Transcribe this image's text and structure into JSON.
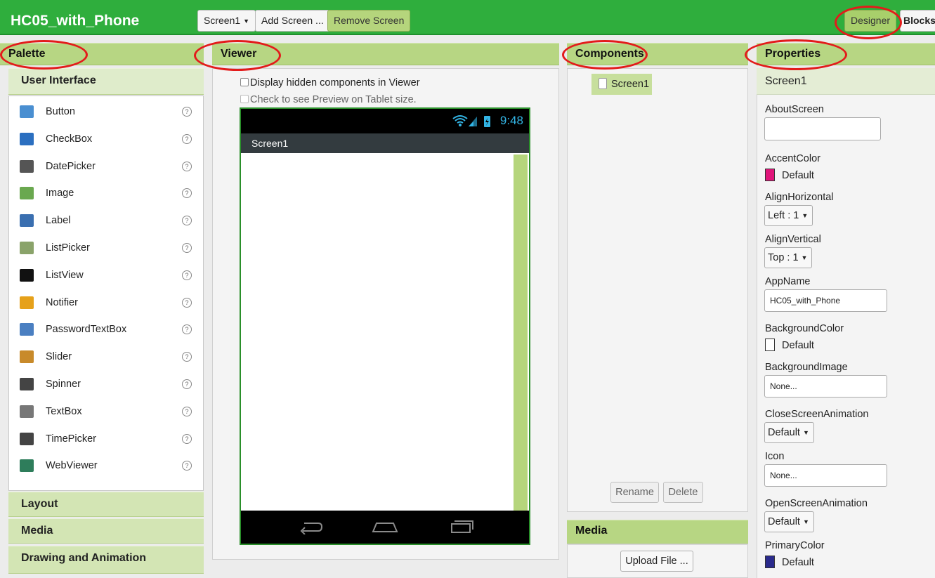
{
  "app": {
    "title": "HC05_with_Phone",
    "screen_selector": "Screen1",
    "add_screen": "Add Screen ...",
    "remove_screen": "Remove Screen",
    "designer": "Designer",
    "blocks": "Blocks"
  },
  "palette": {
    "title": "Palette",
    "category_open": "User Interface",
    "items": [
      {
        "label": "Button",
        "icon": "button-icon",
        "color": "#4a8fd1"
      },
      {
        "label": "CheckBox",
        "icon": "checkbox-icon",
        "color": "#2b6fc0"
      },
      {
        "label": "DatePicker",
        "icon": "datepicker-icon",
        "color": "#555555"
      },
      {
        "label": "Image",
        "icon": "image-icon",
        "color": "#6aa84f"
      },
      {
        "label": "Label",
        "icon": "label-icon",
        "color": "#3a6fb0"
      },
      {
        "label": "ListPicker",
        "icon": "listpicker-icon",
        "color": "#8aa36a"
      },
      {
        "label": "ListView",
        "icon": "listview-icon",
        "color": "#111111"
      },
      {
        "label": "Notifier",
        "icon": "notifier-icon",
        "color": "#e6a11a"
      },
      {
        "label": "PasswordTextBox",
        "icon": "password-icon",
        "color": "#4a7fc1"
      },
      {
        "label": "Slider",
        "icon": "slider-icon",
        "color": "#c88a2a"
      },
      {
        "label": "Spinner",
        "icon": "spinner-icon",
        "color": "#444444"
      },
      {
        "label": "TextBox",
        "icon": "textbox-icon",
        "color": "#777777"
      },
      {
        "label": "TimePicker",
        "icon": "timepicker-icon",
        "color": "#444444"
      },
      {
        "label": "WebViewer",
        "icon": "webviewer-icon",
        "color": "#2e7d5b"
      }
    ],
    "help_glyph": "?",
    "categories": [
      "Layout",
      "Media",
      "Drawing and Animation"
    ]
  },
  "viewer": {
    "title": "Viewer",
    "display_hidden": "Display hidden components in Viewer",
    "tablet_preview": "Check to see Preview on Tablet size.",
    "phone_time": "9:48",
    "screen_title": "Screen1"
  },
  "components": {
    "title": "Components",
    "tree_item": "Screen1",
    "rename": "Rename",
    "delete": "Delete"
  },
  "media": {
    "title": "Media",
    "upload": "Upload File ..."
  },
  "properties": {
    "title": "Properties",
    "component": "Screen1",
    "about_label": "AboutScreen",
    "about_value": "",
    "accent_label": "AccentColor",
    "accent_value": "Default",
    "accent_color": "#e0157a",
    "alignh_label": "AlignHorizontal",
    "alignh_value": "Left : 1",
    "alignv_label": "AlignVertical",
    "alignv_value": "Top : 1",
    "appname_label": "AppName",
    "appname_value": "HC05_with_Phone",
    "bgcolor_label": "BackgroundColor",
    "bgcolor_value": "Default",
    "bgcolor_color": "#ffffff",
    "bgimage_label": "BackgroundImage",
    "bgimage_value": "None...",
    "closeanim_label": "CloseScreenAnimation",
    "closeanim_value": "Default",
    "icon_label": "Icon",
    "icon_value": "None...",
    "openanim_label": "OpenScreenAnimation",
    "openanim_value": "Default",
    "primary_label": "PrimaryColor",
    "primary_value": "Default",
    "primary_color": "#2a2a8c"
  },
  "colors": {
    "topbar": "#2fae3d",
    "panel_header": "#b7d683",
    "annotation_ring": "#e31b1b"
  }
}
